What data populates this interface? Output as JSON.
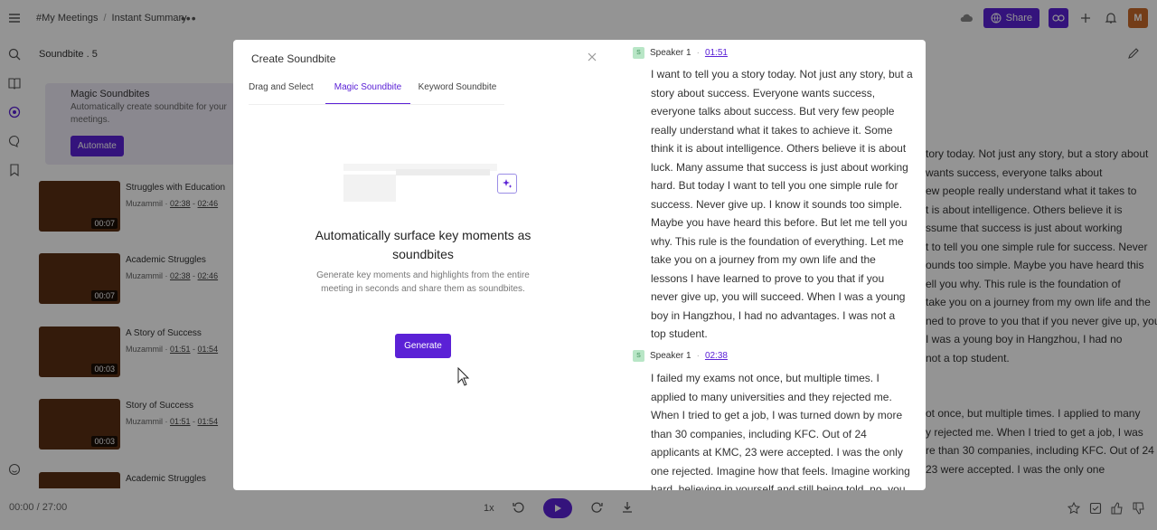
{
  "header": {
    "crumb1": "#My Meetings",
    "crumb2": "Instant Summary",
    "share_label": "Share",
    "avatar_initial": "M"
  },
  "panel": {
    "title": "Soundbite . 5",
    "magic_title": "Magic Soundbites",
    "magic_desc": "Automatically create soundbite for your meetings.",
    "automate_label": "Automate",
    "items": [
      {
        "title": "Struggles with Education",
        "author": "Muzammil",
        "start": "02:38",
        "end": "02:46",
        "duration": "00:07"
      },
      {
        "title": "Academic Struggles",
        "author": "Muzammil",
        "start": "02:38",
        "end": "02:46",
        "duration": "00:07"
      },
      {
        "title": "A Story of Success",
        "author": "Muzammil",
        "start": "01:51",
        "end": "01:54",
        "duration": "00:03"
      },
      {
        "title": "Story of Success",
        "author": "Muzammil",
        "start": "01:51",
        "end": "01:54",
        "duration": "00:03"
      },
      {
        "title": "Academic Struggles",
        "author": "",
        "start": "",
        "end": "",
        "duration": ""
      }
    ]
  },
  "background_transcript": {
    "lines": [
      "tory today. Not just any story, but a story about",
      "wants success, everyone talks about",
      "ew people really understand what it takes to",
      "t is about intelligence. Others believe it is",
      "ssume that success is just about working",
      "t to tell you one simple rule for success. Never",
      "ounds too simple. Maybe you have heard this",
      "ell you why. This rule is the foundation of",
      "take you on a journey from my own life and the",
      "ned to prove to you that if you never give up, you",
      "I was a young boy in Hangzhou, I had no",
      "not a top student.",
      "",
      "",
      "ot once, but multiple times. I applied to many",
      "y rejected me. When I tried to get a job, I was",
      "re than 30 companies, including KFC. Out of 24",
      "23 were accepted. I was the only one"
    ]
  },
  "player": {
    "time": "00:00 / 27:00",
    "speed": "1x"
  },
  "modal": {
    "title": "Create Soundbite",
    "tabs": [
      "Drag and Select",
      "Magic Soundbite",
      "Keyword Soundbite"
    ],
    "heading": "Automatically surface key moments as soundbites",
    "description": "Generate key moments and highlights from the entire meeting in seconds and share them as soundbites.",
    "generate_label": "Generate",
    "transcript": [
      {
        "speaker_initial": "S",
        "speaker": "Speaker 1",
        "time": "01:51",
        "text": "I want to tell you a story today. Not just any story, but a story about success. Everyone wants success, everyone talks about success. But very few people really understand what it takes to achieve it. Some think it is about intelligence. Others believe it is about luck. Many assume that success is just about working hard. But today I want to tell you one simple rule for success. Never give up. I know it sounds too simple. Maybe you have heard this before. But let me tell you why. This rule is the foundation of everything. Let me take you on a journey from my own life and the lessons I have learned to prove to you that if you never give up, you will succeed. When I was a young boy in Hangzhou, I had no advantages. I was not a top student."
      },
      {
        "speaker_initial": "S",
        "speaker": "Speaker 1",
        "time": "02:38",
        "text": "I failed my exams not once, but multiple times. I applied to many universities and they rejected me. When I tried to get a job, I was turned down by more than 30 companies, including KFC. Out of 24 applicants at KMC, 23 were accepted. I was the only one rejected. Imagine how that feels. Imagine working hard, believing in yourself and still being told, no, you are not good"
      }
    ]
  }
}
